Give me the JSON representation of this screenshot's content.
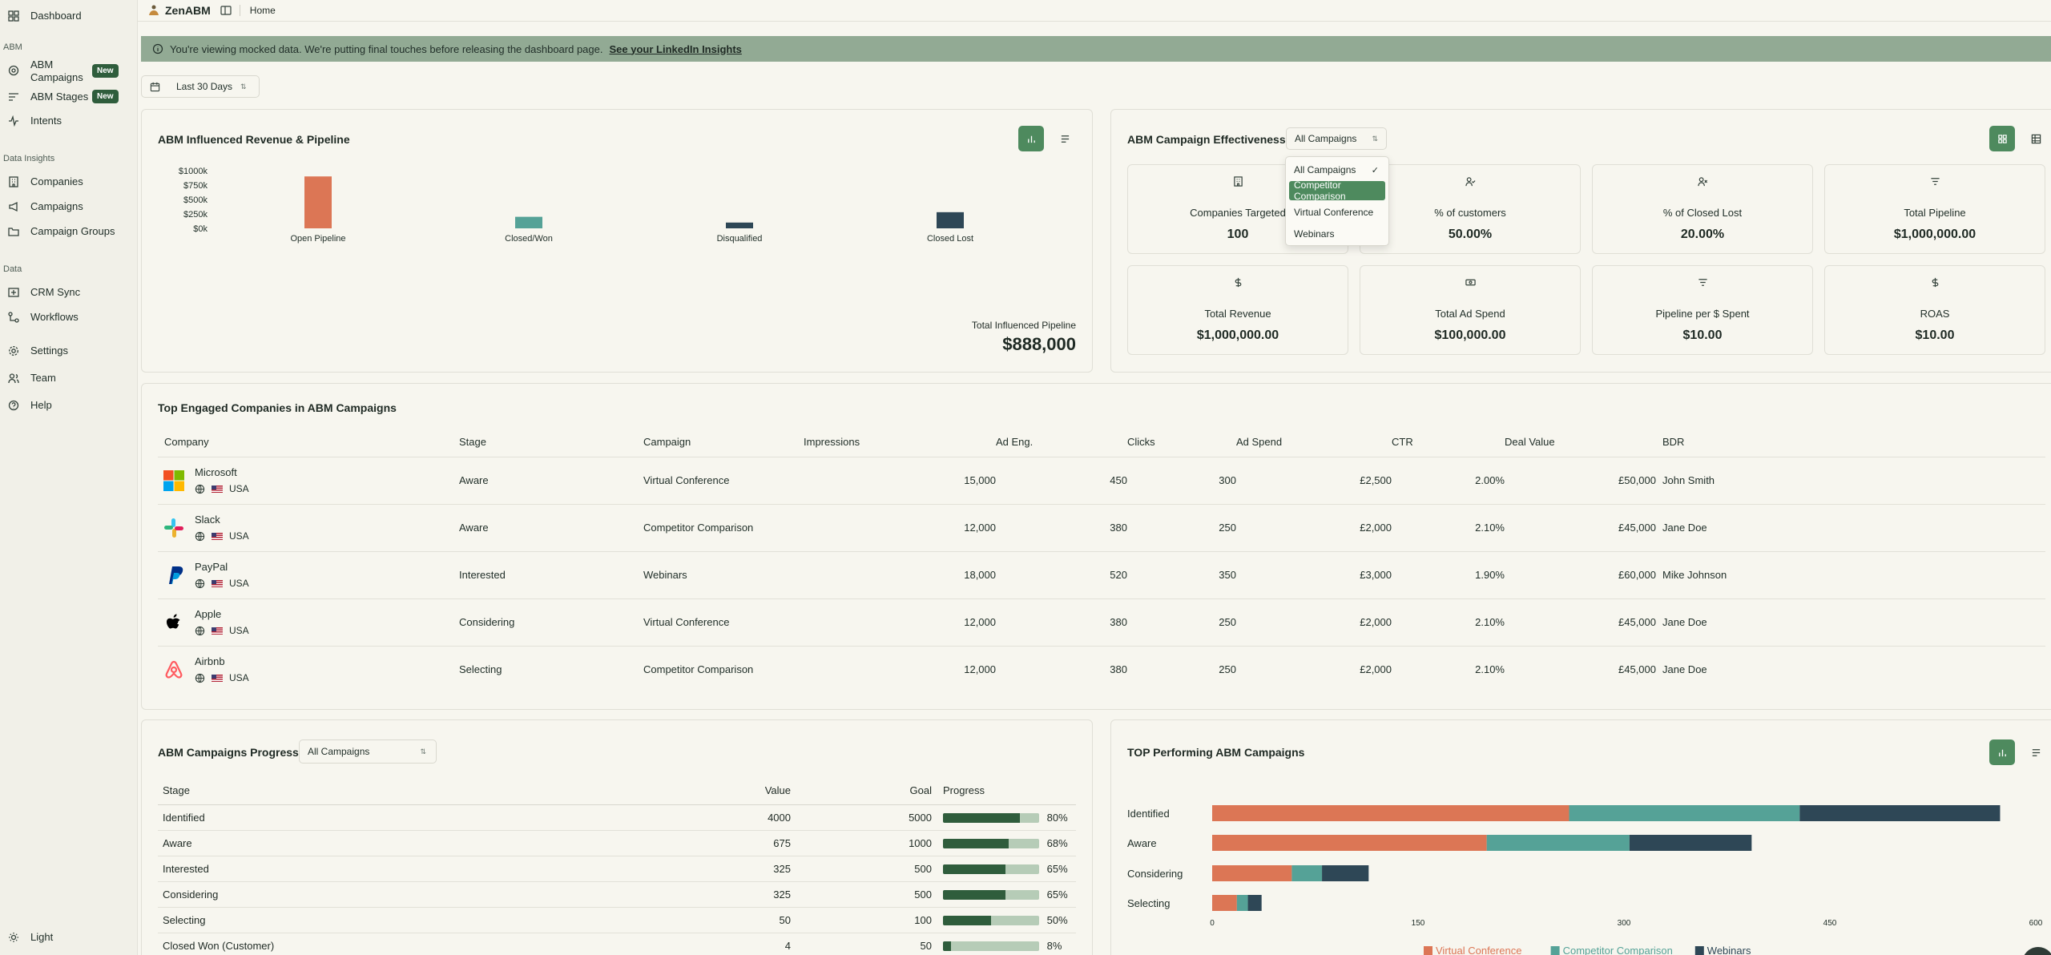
{
  "sidebar": {
    "dashboard": "Dashboard",
    "sec_abm": "ABM",
    "abm_campaigns_l1": "ABM",
    "abm_campaigns_l2": "Campaigns",
    "badge_new": "New",
    "abm_stages": "ABM Stages",
    "intents": "Intents",
    "sec_data_insights": "Data Insights",
    "companies": "Companies",
    "campaigns": "Campaigns",
    "campaign_groups": "Campaign Groups",
    "sec_data": "Data",
    "crm_sync": "CRM Sync",
    "workflows": "Workflows",
    "settings": "Settings",
    "team": "Team",
    "help": "Help",
    "theme": "Light"
  },
  "topbar": {
    "brand": "ZenABM",
    "breadcrumb": "Home"
  },
  "banner": {
    "text": "You're viewing mocked data. We're putting final touches before releasing the dashboard page.",
    "link": "See your LinkedIn Insights"
  },
  "date_filter": "Last 30 Days",
  "revenue": {
    "title": "ABM Influenced Revenue & Pipeline",
    "total_label": "Total Influenced Pipeline",
    "total_value": "$888,000"
  },
  "chart_data": [
    {
      "type": "bar",
      "categories": [
        "Open Pipeline",
        "Closed/Won",
        "Disqualified",
        "Closed Lost"
      ],
      "values": [
        900,
        200,
        100,
        280
      ],
      "y_ticks": [
        "$1000k",
        "$750k",
        "$500k",
        "$250k",
        "$0k"
      ],
      "ylim": [
        0,
        1000
      ],
      "colors": [
        "#dc7655",
        "#55a297",
        "#2e4756",
        "#2e4756"
      ],
      "grid": false
    },
    {
      "type": "bar",
      "orientation": "horizontal",
      "stacked": true,
      "categories": [
        "Identified",
        "Aware",
        "Considering",
        "Selecting"
      ],
      "series": [
        {
          "name": "Virtual Conference",
          "color": "#dc7655",
          "values": [
            260,
            200,
            58,
            18
          ]
        },
        {
          "name": "Competitor Comparison",
          "color": "#55a297",
          "values": [
            168,
            104,
            22,
            8
          ]
        },
        {
          "name": "Webinars",
          "color": "#2e4756",
          "values": [
            146,
            89,
            34,
            10
          ]
        }
      ],
      "x_ticks": [
        "0",
        "150",
        "300",
        "450",
        "600"
      ],
      "xlim": [
        0,
        600
      ],
      "legend": "bottom"
    }
  ],
  "effectiveness": {
    "title": "ABM Campaign Effectiveness",
    "select": "All Campaigns",
    "metrics": [
      {
        "label": "Companies Targeted",
        "value": "100",
        "icon": "building-icon"
      },
      {
        "label": "% of customers",
        "value": "50.00%",
        "icon": "user-check-icon"
      },
      {
        "label": "% of Closed Lost",
        "value": "20.00%",
        "icon": "user-x-icon"
      },
      {
        "label": "Total Pipeline",
        "value": "$1,000,000.00",
        "icon": "filter-icon"
      },
      {
        "label": "Total Revenue",
        "value": "$1,000,000.00",
        "icon": "dollar-icon"
      },
      {
        "label": "Total Ad Spend",
        "value": "$100,000.00",
        "icon": "banknote-icon"
      },
      {
        "label": "Pipeline per $ Spent",
        "value": "$10.00",
        "icon": "filter-icon"
      },
      {
        "label": "ROAS",
        "value": "$10.00",
        "icon": "dollar-icon"
      }
    ],
    "dropdown": [
      "All Campaigns",
      "Competitor Comparison",
      "Virtual Conference",
      "Webinars"
    ]
  },
  "engaged": {
    "title": "Top Engaged Companies in ABM Campaigns",
    "headers": [
      "Company",
      "Stage",
      "Campaign",
      "Impressions",
      "Ad Eng.",
      "Clicks",
      "Ad Spend",
      "CTR",
      "Deal Value",
      "BDR"
    ],
    "country": "USA",
    "rows": [
      {
        "name": "Microsoft",
        "stage": "Aware",
        "campaign": "Virtual Conference",
        "impressions": "15,000",
        "eng": "450",
        "clicks": "300",
        "spend": "£2,500",
        "ctr": "2.00%",
        "deal": "£50,000",
        "bdr": "John Smith"
      },
      {
        "name": "Slack",
        "stage": "Aware",
        "campaign": "Competitor Comparison",
        "impressions": "12,000",
        "eng": "380",
        "clicks": "250",
        "spend": "£2,000",
        "ctr": "2.10%",
        "deal": "£45,000",
        "bdr": "Jane Doe"
      },
      {
        "name": "PayPal",
        "stage": "Interested",
        "campaign": "Webinars",
        "impressions": "18,000",
        "eng": "520",
        "clicks": "350",
        "spend": "£3,000",
        "ctr": "1.90%",
        "deal": "£60,000",
        "bdr": "Mike Johnson"
      },
      {
        "name": "Apple",
        "stage": "Considering",
        "campaign": "Virtual Conference",
        "impressions": "12,000",
        "eng": "380",
        "clicks": "250",
        "spend": "£2,000",
        "ctr": "2.10%",
        "deal": "£45,000",
        "bdr": "Jane Doe"
      },
      {
        "name": "Airbnb",
        "stage": "Selecting",
        "campaign": "Competitor Comparison",
        "impressions": "12,000",
        "eng": "380",
        "clicks": "250",
        "spend": "£2,000",
        "ctr": "2.10%",
        "deal": "£45,000",
        "bdr": "Jane Doe"
      }
    ]
  },
  "progress": {
    "title": "ABM Campaigns Progress",
    "select": "All Campaigns",
    "headers": [
      "Stage",
      "Value",
      "Goal",
      "Progress"
    ],
    "rows": [
      {
        "stage": "Identified",
        "value": "4000",
        "goal": "5000",
        "pct": 80,
        "pct_label": "80%"
      },
      {
        "stage": "Aware",
        "value": "675",
        "goal": "1000",
        "pct": 68,
        "pct_label": "68%"
      },
      {
        "stage": "Interested",
        "value": "325",
        "goal": "500",
        "pct": 65,
        "pct_label": "65%"
      },
      {
        "stage": "Considering",
        "value": "325",
        "goal": "500",
        "pct": 65,
        "pct_label": "65%"
      },
      {
        "stage": "Selecting",
        "value": "50",
        "goal": "100",
        "pct": 50,
        "pct_label": "50%"
      },
      {
        "stage": "Closed Won (Customer)",
        "value": "4",
        "goal": "50",
        "pct": 8,
        "pct_label": "8%"
      }
    ]
  },
  "top_perf": {
    "title": "TOP Performing ABM Campaigns"
  }
}
